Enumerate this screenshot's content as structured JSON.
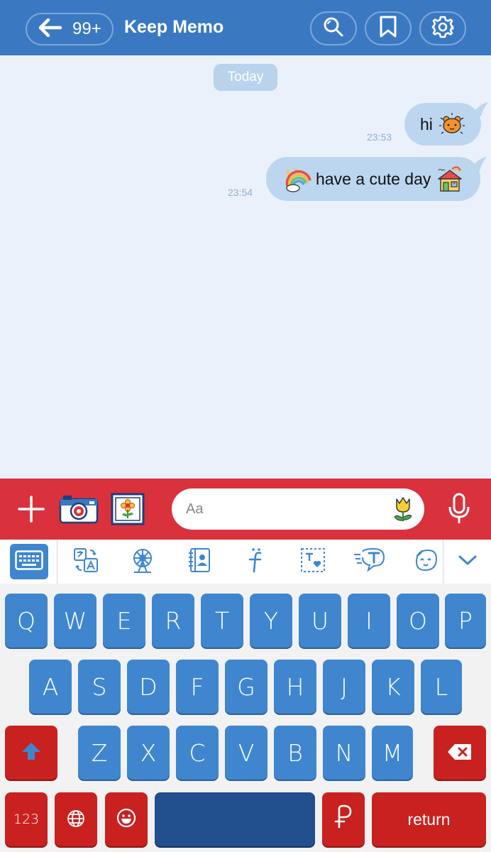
{
  "header": {
    "unread_count": "99+",
    "title": "Keep Memo",
    "icons": [
      "back-arrow-icon",
      "search-icon",
      "bookmark-icon",
      "settings-gear-icon"
    ]
  },
  "chat": {
    "date_label": "Today",
    "messages": [
      {
        "text": "hi",
        "time": "23:53",
        "stickers": [
          "bear-face-emoji"
        ]
      },
      {
        "text": "have a cute day",
        "time": "23:54",
        "stickers": [
          "rainbow-emoji",
          "house-emoji"
        ]
      }
    ]
  },
  "input": {
    "placeholder": "Aa",
    "icons": [
      "plus-icon",
      "camera-icon",
      "gallery-flower-icon",
      "tulip-sticker-icon",
      "microphone-icon"
    ]
  },
  "toolbar": {
    "icons": [
      "keyboard-icon",
      "translate-icon",
      "ferris-wheel-icon",
      "contacts-book-icon",
      "font-icon",
      "text-frame-icon",
      "speech-t-icon",
      "face-sticker-icon",
      "chevron-down-icon"
    ]
  },
  "keyboard": {
    "row1": [
      "Q",
      "W",
      "E",
      "R",
      "T",
      "Y",
      "U",
      "I",
      "O",
      "P"
    ],
    "row2": [
      "A",
      "S",
      "D",
      "F",
      "G",
      "H",
      "J",
      "K",
      "L"
    ],
    "row3": [
      "Z",
      "X",
      "C",
      "V",
      "B",
      "N",
      "M"
    ],
    "numbers_label": "123",
    "return_label": "return"
  },
  "colors": {
    "header": "#3a78c2",
    "chat_bg": "#eaf1fa",
    "bubble": "#bcd6ef",
    "input_bar": "#d9323d",
    "key_blue": "#3f86cf",
    "key_red": "#c9211f",
    "key_space": "#224f8e"
  }
}
